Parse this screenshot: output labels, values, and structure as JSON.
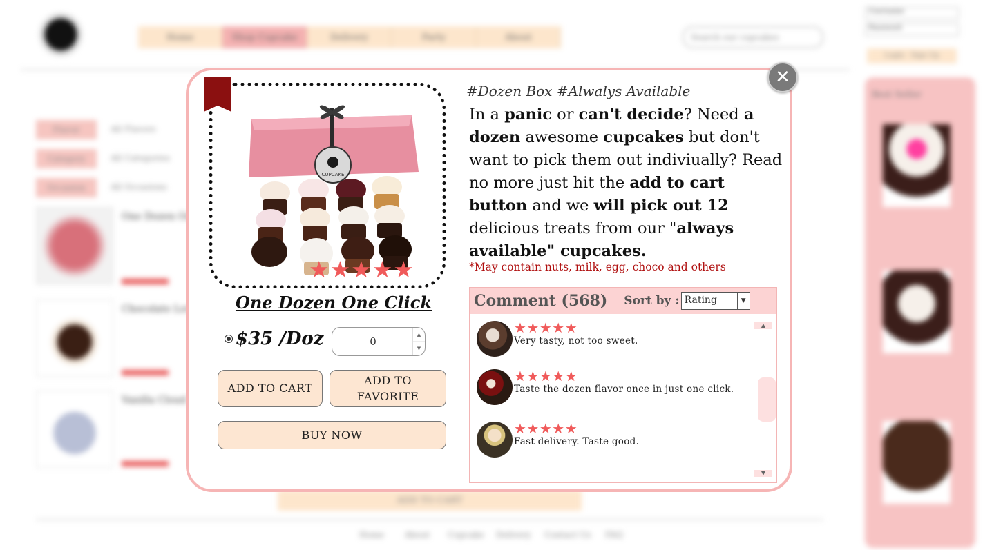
{
  "background": {
    "nav_items": [
      "Home",
      "Shop Cupcake",
      "Delivery",
      "Party",
      "About"
    ],
    "search_placeholder": "Search our cupcakes",
    "login_fields": [
      "Username",
      "Password"
    ],
    "login_buttons": "Login · Sign Up",
    "filters": [
      "Flavor",
      "Category",
      "Occasion"
    ],
    "filter_values": [
      "All Flavors",
      "All Categories",
      "All Occasions"
    ],
    "products": [
      "One Dozen One Click",
      "Chocolate Lover",
      "Vanilla Cloud"
    ],
    "sidebar_title": "Best Seller",
    "bottom_add_to_cart": "ADD TO CART",
    "footer_links": [
      "Home",
      "About",
      "Cupcake",
      "Delivery",
      "Contact Us",
      "FAQ"
    ]
  },
  "modal": {
    "close_icon": "close-icon",
    "rating_stars": "★★★★★",
    "rating_value": 5,
    "product_title": "One Dozen One Click",
    "price": "$35 /Doz",
    "quantity": "0",
    "add_to_cart": "ADD TO CART",
    "add_to_favorite": "ADD TO FAVORITE",
    "buy_now": "BUY NOW",
    "tags": "#Dozen Box #Alwalys Available",
    "description_parts": [
      "In a ",
      "panic",
      " or ",
      "can't decide",
      "? Need ",
      "a dozen",
      " awesome ",
      "cupcakes",
      " but don't want to pick them out indiviually? Read no more just hit the ",
      "add to cart button",
      " and we ",
      "will pick out 12",
      " delicious treats from our \"",
      "always available\" cupcakes."
    ],
    "warning": "*May contain nuts, milk, egg, choco and others",
    "comments": {
      "title": "Comment (568)",
      "sort_label": "Sort by :",
      "sort_value": "Rating",
      "items": [
        {
          "stars": "★★★★★",
          "rating": 5,
          "text": "Very tasty, not too sweet.",
          "avatar_icon": "user-avatar-icon"
        },
        {
          "stars": "★★★★★",
          "rating": 5,
          "text": "Taste the dozen flavor once in just one click.",
          "avatar_icon": "user-avatar-icon"
        },
        {
          "stars": "★★★★★",
          "rating": 5,
          "text": "Fast delivery. Taste good.",
          "avatar_icon": "user-avatar-icon"
        }
      ]
    }
  },
  "colors": {
    "modal_border": "#f6b5b5",
    "star": "#f05a5a",
    "button_fill": "#fde6d2",
    "bookmark": "#8b1010",
    "warning": "#b01010",
    "comment_header": "#fcd3d3"
  }
}
